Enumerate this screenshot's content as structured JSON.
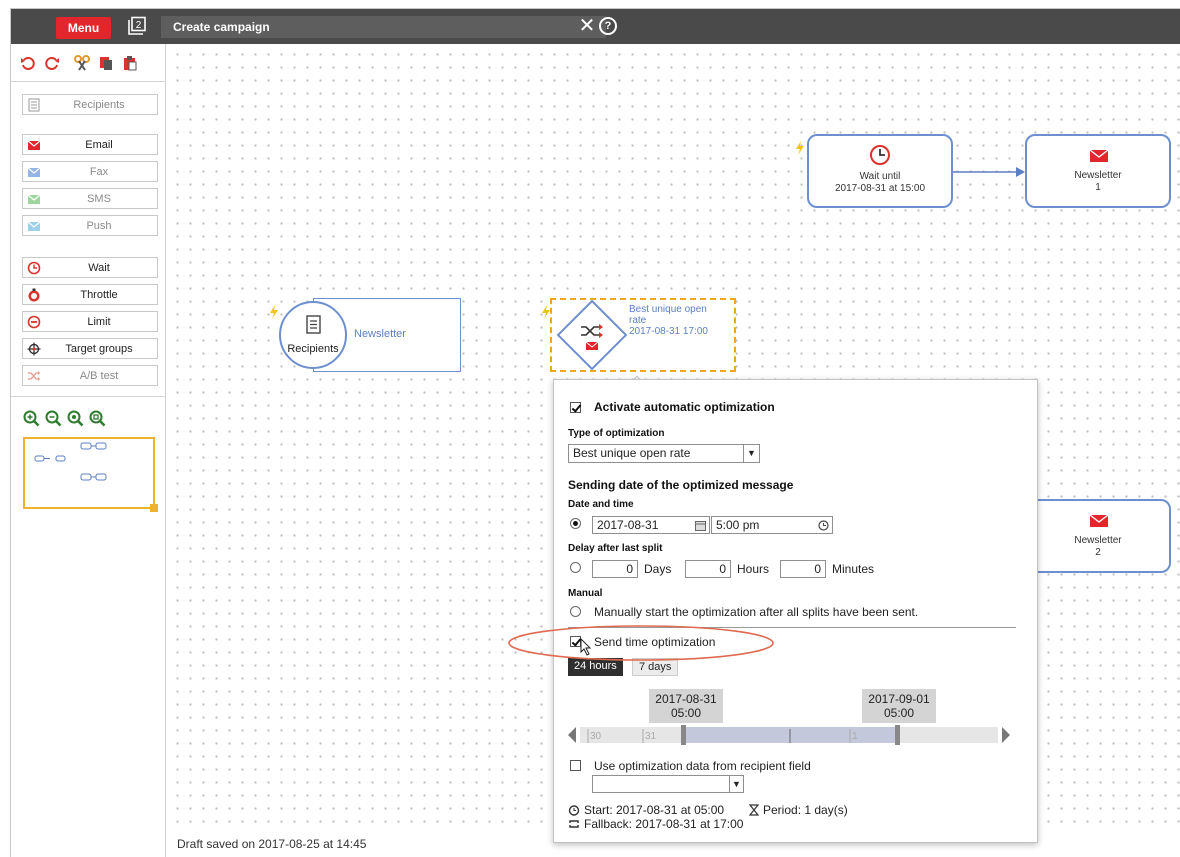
{
  "topbar": {
    "menu_label": "Menu",
    "window_count": "2",
    "title": "Create campaign",
    "close_glyph": "✕",
    "help_glyph": "?"
  },
  "sidebar": {
    "toolbar_icons": [
      "undo-icon",
      "redo-icon",
      "cut-icon",
      "copy-icon",
      "paste-icon"
    ],
    "tools": [
      {
        "label": "Recipients",
        "icon": "recipients-icon"
      },
      {
        "label": "Email",
        "icon": "email-icon"
      },
      {
        "label": "Fax",
        "icon": "fax-icon"
      },
      {
        "label": "SMS",
        "icon": "sms-icon"
      },
      {
        "label": "Push",
        "icon": "push-icon"
      },
      {
        "label": "Wait",
        "icon": "clock-icon"
      },
      {
        "label": "Throttle",
        "icon": "throttle-icon"
      },
      {
        "label": "Limit",
        "icon": "limit-icon"
      },
      {
        "label": "Target groups",
        "icon": "target-icon"
      },
      {
        "label": "A/B test",
        "icon": "shuffle-icon"
      }
    ],
    "zoom_icons": [
      "zoom-in-icon",
      "zoom-out-icon",
      "zoom-reset-icon",
      "zoom-fit-icon"
    ]
  },
  "canvas": {
    "recipients_node": {
      "label": "Recipients",
      "target": "Newsletter"
    },
    "ab_node": {
      "line1": "Best unique open",
      "line2": "rate",
      "line3": "2017-08-31 17:00"
    },
    "wait_node": {
      "line1": "Wait until",
      "line2": "2017-08-31 at 15:00"
    },
    "newsletter1": {
      "line1": "Newsletter",
      "line2": "1"
    },
    "newsletter2": {
      "line1": "Newsletter",
      "line2": "2"
    }
  },
  "status": {
    "text": "Draft saved on 2017-08-25 at 14:45"
  },
  "popup": {
    "activate_label": "Activate automatic optimization",
    "type_label": "Type of optimization",
    "type_value": "Best unique open rate",
    "sending_heading": "Sending date of the optimized message",
    "date_time_label": "Date and time",
    "date_value": "2017-08-31",
    "time_value": "5:00 pm",
    "delay_label": "Delay after last split",
    "days_value": "0",
    "days_unit": "Days",
    "hours_value": "0",
    "hours_unit": "Hours",
    "minutes_value": "0",
    "minutes_unit": "Minutes",
    "manual_label": "Manual",
    "manual_option": "Manually start the optimization after all splits have been sent.",
    "sto_label": "Send time optimization",
    "tab_24": "24 hours",
    "tab_7": "7 days",
    "range_start_date": "2017-08-31",
    "range_start_time": "05:00",
    "range_end_date": "2017-09-01",
    "range_end_time": "05:00",
    "ticks": [
      "30",
      "31",
      "1"
    ],
    "use_field_label": "Use optimization data from recipient field",
    "start_text": "Start: 2017-08-31 at 05:00",
    "period_text": "Period: 1 day(s)",
    "fallback_text": "Fallback: 2017-08-31 at 17:00"
  },
  "colors": {
    "accent_red": "#e3262b",
    "node_border": "#6e8fcf",
    "highlight_orange": "#f0a61c",
    "annotation_red": "#e06a4f"
  }
}
